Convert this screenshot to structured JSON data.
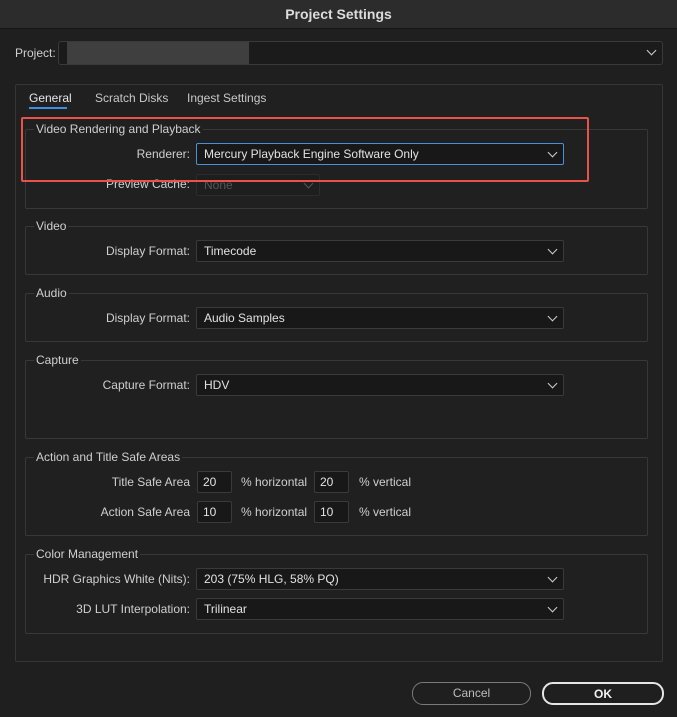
{
  "window": {
    "title": "Project Settings"
  },
  "project": {
    "label": "Project:",
    "value": ""
  },
  "tabs": [
    {
      "label": "General",
      "active": true
    },
    {
      "label": "Scratch Disks",
      "active": false
    },
    {
      "label": "Ingest Settings",
      "active": false
    }
  ],
  "video_rendering": {
    "title": "Video Rendering and Playback",
    "renderer_label": "Renderer:",
    "renderer_value": "Mercury Playback Engine Software Only",
    "preview_cache_label": "Preview Cache:",
    "preview_cache_value": "None"
  },
  "video": {
    "title": "Video",
    "display_format_label": "Display Format:",
    "display_format_value": "Timecode"
  },
  "audio": {
    "title": "Audio",
    "display_format_label": "Display Format:",
    "display_format_value": "Audio Samples"
  },
  "capture": {
    "title": "Capture",
    "capture_format_label": "Capture Format:",
    "capture_format_value": "HDV"
  },
  "safe_areas": {
    "title": "Action and Title Safe Areas",
    "title_safe_label": "Title Safe Area",
    "title_safe_h": "20",
    "title_safe_v": "20",
    "action_safe_label": "Action Safe Area",
    "action_safe_h": "10",
    "action_safe_v": "10",
    "horizontal_unit": "% horizontal",
    "vertical_unit": "% vertical"
  },
  "color_management": {
    "title": "Color Management",
    "hdr_label": "HDR Graphics White (Nits):",
    "hdr_value": "203 (75% HLG, 58% PQ)",
    "lut_label": "3D LUT Interpolation:",
    "lut_value": "Trilinear"
  },
  "buttons": {
    "cancel": "Cancel",
    "ok": "OK"
  },
  "colors": {
    "accent": "#3d8ee6",
    "highlight": "#e5534b",
    "background": "#1f1f1f"
  },
  "icons": {
    "dropdown": "chevron-down-icon"
  }
}
